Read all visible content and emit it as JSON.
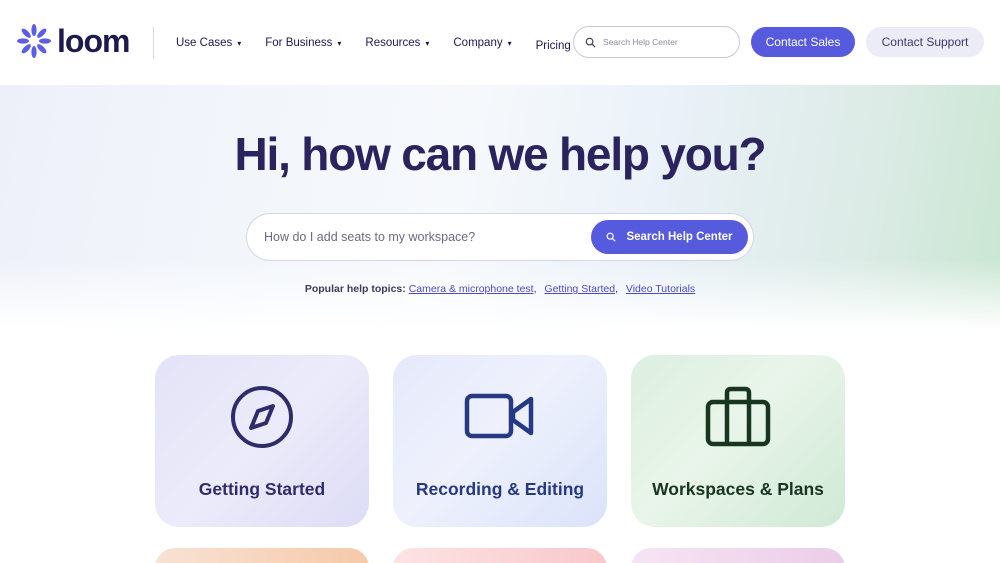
{
  "brand": {
    "name": "loom",
    "accent": "#565add"
  },
  "nav": {
    "items": [
      {
        "label": "Use Cases",
        "caret": "▾"
      },
      {
        "label": "For Business",
        "caret": "▾"
      },
      {
        "label": "Resources",
        "caret": "▾"
      },
      {
        "label": "Company",
        "caret": "▾"
      }
    ],
    "pricing": "Pricing"
  },
  "header": {
    "search_placeholder": "Search Help Center",
    "contact_sales": "Contact Sales",
    "contact_support": "Contact Support"
  },
  "hero": {
    "title": "Hi, how can we help you?",
    "search_placeholder": "How do I add seats to my workspace?",
    "search_button": "Search Help Center",
    "popular_label": "Popular help topics:",
    "popular_topics": [
      "Camera & microphone test",
      "Getting Started",
      "Video Tutorials"
    ],
    "separator": ","
  },
  "cards": [
    {
      "label": "Getting Started",
      "icon": "compass-icon"
    },
    {
      "label": "Recording & Editing",
      "icon": "video-camera-icon"
    },
    {
      "label": "Workspaces & Plans",
      "icon": "briefcase-icon"
    }
  ]
}
